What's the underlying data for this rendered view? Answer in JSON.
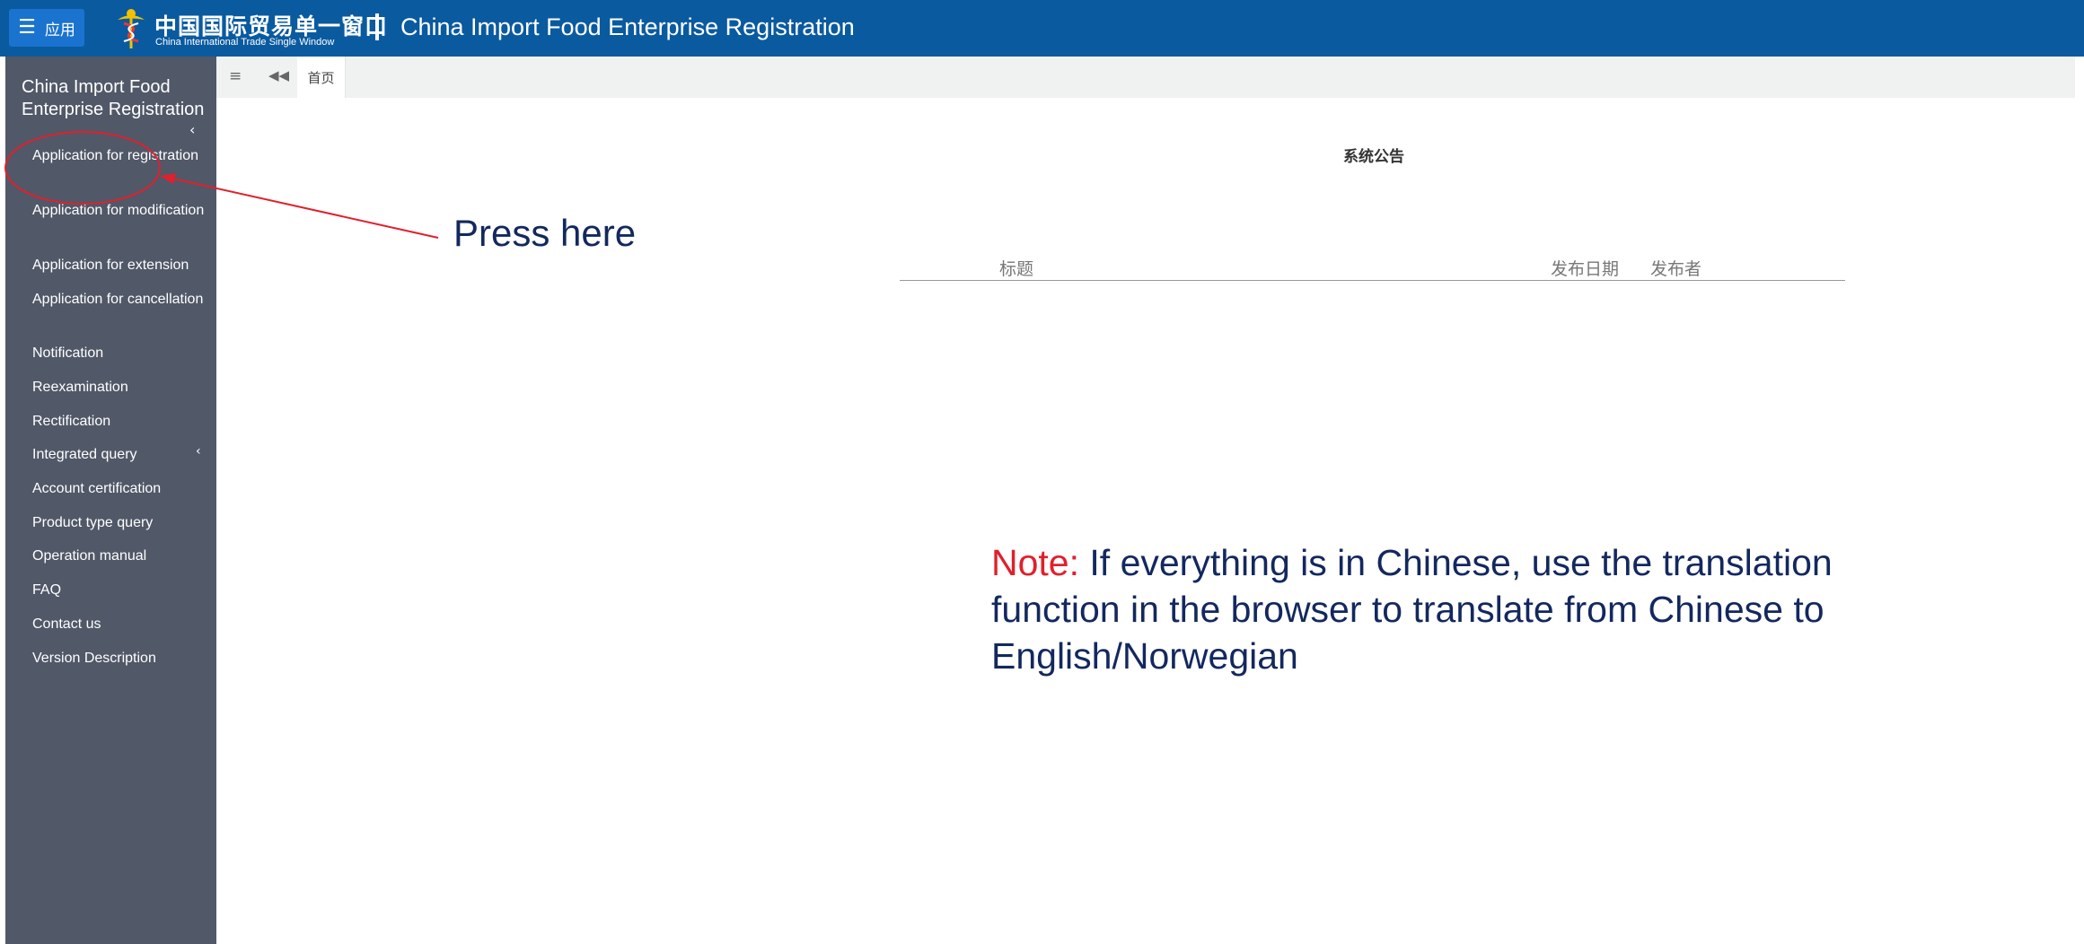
{
  "header": {
    "app_button_label": "应用",
    "logo_cn": "中国国际贸易单一窗口",
    "logo_en": "China International Trade Single Window",
    "app_title": "China Import Food Enterprise Registration"
  },
  "sidebar": {
    "title": "China Import Food Enterprise Registration",
    "items": [
      {
        "label": "Application for registration"
      },
      {
        "label": "Application for modification"
      },
      {
        "label": "Application for extension"
      },
      {
        "label": "Application for cancellation"
      },
      {
        "label": "Notification"
      },
      {
        "label": "Reexamination"
      },
      {
        "label": "Rectification"
      },
      {
        "label": "Integrated query"
      },
      {
        "label": "Account certification"
      },
      {
        "label": "Product type query"
      },
      {
        "label": "Operation manual"
      },
      {
        "label": "FAQ"
      },
      {
        "label": "Contact us"
      },
      {
        "label": "Version Description"
      }
    ]
  },
  "tabs": {
    "home_label": "首页"
  },
  "notice": {
    "title": "系统公告",
    "columns": [
      "标题",
      "发布日期",
      "发布者"
    ]
  },
  "annotations": {
    "press_here": "Press here",
    "note_prefix": "Note:",
    "note_text": "If everything is in Chinese, use the translation function in the browser to translate from Chinese to English/Norwegian"
  },
  "colors": {
    "topbar": "#0a5aa0",
    "sidebar": "#515868",
    "annotation_red": "#e0202c",
    "annotation_text": "#13285e"
  }
}
